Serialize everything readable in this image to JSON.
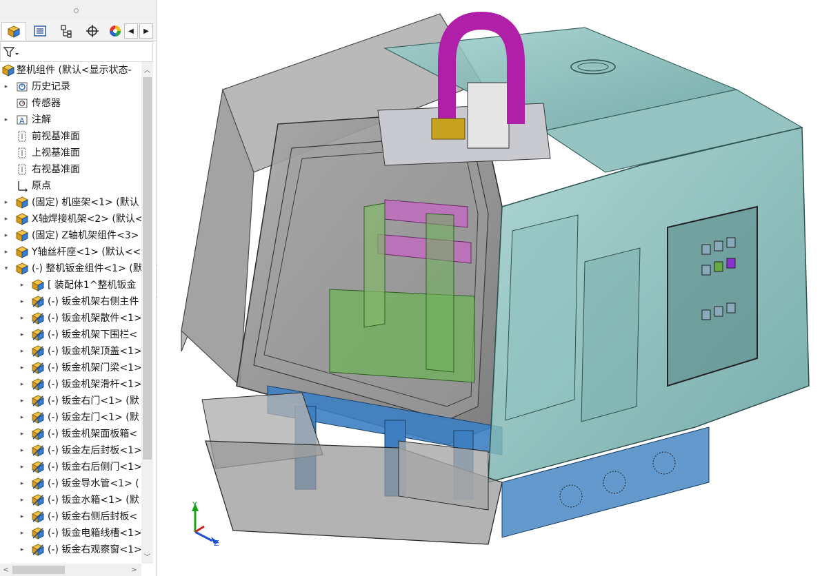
{
  "feature_tree": {
    "root_label": "整机组件 (默认<显示状态-",
    "items": [
      {
        "label": "历史记录",
        "icon": "history-icon",
        "level": 1,
        "expander": "right"
      },
      {
        "label": "传感器",
        "icon": "sensor-icon",
        "level": 1,
        "expander": "none"
      },
      {
        "label": "注解",
        "icon": "annotation-icon",
        "level": 1,
        "expander": "right"
      },
      {
        "label": "前视基准面",
        "icon": "plane-icon",
        "level": 1,
        "expander": "none"
      },
      {
        "label": "上视基准面",
        "icon": "plane-icon",
        "level": 1,
        "expander": "none"
      },
      {
        "label": "右视基准面",
        "icon": "plane-icon",
        "level": 1,
        "expander": "none"
      },
      {
        "label": "原点",
        "icon": "origin-icon",
        "level": 1,
        "expander": "none"
      },
      {
        "label": "(固定) 机座架<1> (默认",
        "icon": "assembly-icon",
        "level": 1,
        "expander": "right"
      },
      {
        "label": "X轴焊接机架<2> (默认<",
        "icon": "assembly-icon",
        "level": 1,
        "expander": "right"
      },
      {
        "label": "(固定) Z轴机架组件<3>",
        "icon": "assembly-icon",
        "level": 1,
        "expander": "right"
      },
      {
        "label": "Y轴丝杆座<1> (默认<<",
        "icon": "assembly-icon",
        "level": 1,
        "expander": "right"
      },
      {
        "label": "(-) 整机钣金组件<1> (默",
        "icon": "assembly-icon",
        "level": 1,
        "expander": "down"
      },
      {
        "label": "[ 装配体1^整机钣金",
        "icon": "assembly-icon",
        "level": 2,
        "expander": "right"
      },
      {
        "label": "(-) 钣金机架右侧主件",
        "icon": "part-icon",
        "level": 2,
        "expander": "right"
      },
      {
        "label": "(-) 钣金机架散件<1>",
        "icon": "part-icon",
        "level": 2,
        "expander": "right"
      },
      {
        "label": "(-) 钣金机架下围栏<",
        "icon": "part-icon",
        "level": 2,
        "expander": "right"
      },
      {
        "label": "(-) 钣金机架顶盖<1>",
        "icon": "part-icon",
        "level": 2,
        "expander": "right"
      },
      {
        "label": "(-) 钣金机架门梁<1>",
        "icon": "part-icon",
        "level": 2,
        "expander": "right"
      },
      {
        "label": "(-) 钣金机架滑杆<1>",
        "icon": "part-icon",
        "level": 2,
        "expander": "right"
      },
      {
        "label": "(-) 钣金右门<1> (默",
        "icon": "part-icon",
        "level": 2,
        "expander": "right"
      },
      {
        "label": "(-) 钣金左门<1> (默",
        "icon": "part-icon",
        "level": 2,
        "expander": "right"
      },
      {
        "label": "(-) 钣金机架面板箱<",
        "icon": "part-icon",
        "level": 2,
        "expander": "right"
      },
      {
        "label": "(-) 钣金左后封板<1>",
        "icon": "part-icon",
        "level": 2,
        "expander": "right"
      },
      {
        "label": "(-) 钣金右后侧门<1>",
        "icon": "part-icon",
        "level": 2,
        "expander": "right"
      },
      {
        "label": "(-) 钣金导水管<1> (",
        "icon": "part-icon",
        "level": 2,
        "expander": "right"
      },
      {
        "label": "(-) 钣金水箱<1> (默",
        "icon": "part-icon",
        "level": 2,
        "expander": "right"
      },
      {
        "label": "(-) 钣金右侧后封板<",
        "icon": "part-icon",
        "level": 2,
        "expander": "right"
      },
      {
        "label": "(-) 钣金电箱线槽<1>",
        "icon": "part-icon",
        "level": 2,
        "expander": "right"
      },
      {
        "label": "(-) 钣金右观察窗<1>",
        "icon": "part-icon",
        "level": 2,
        "expander": "right"
      }
    ]
  },
  "panel_tabs": [
    "feature-manager-tab",
    "property-manager-tab",
    "configuration-manager-tab",
    "dimxpert-tab",
    "display-manager-tab"
  ],
  "triad": {
    "x": "",
    "y": "Y",
    "z": "Z"
  },
  "colors": {
    "cabinet": "#7fb7b5",
    "frame_blue": "#3d7fc1",
    "cable_chain": "#b01fa8",
    "plate_magenta": "#c06bbd",
    "green": "#6fb35a",
    "gray_body": "#8c8c8c"
  }
}
